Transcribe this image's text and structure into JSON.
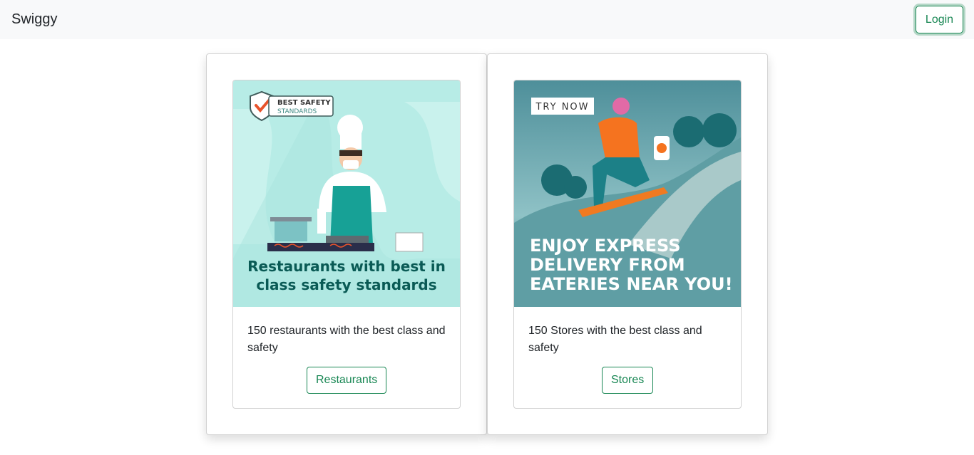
{
  "navbar": {
    "brand": "Swiggy",
    "login_label": "Login"
  },
  "cards": [
    {
      "banner": {
        "badge_line1": "BEST SAFETY",
        "badge_line2": "STANDARDS",
        "headline_line1": "Restaurants with best in",
        "headline_line2": "class safety standards"
      },
      "text": "150 restaurants with the best class and safety",
      "button_label": "Restaurants"
    },
    {
      "banner": {
        "tag": "TRY NOW",
        "headline_line1": "ENJOY EXPRESS",
        "headline_line2": "DELIVERY FROM",
        "headline_line3": "EATERIES NEAR YOU!"
      },
      "text": "150 Stores with the best class and safety",
      "button_label": "Stores"
    }
  ],
  "colors": {
    "accent": "#198754",
    "navbar_bg": "#f8f9fa"
  }
}
